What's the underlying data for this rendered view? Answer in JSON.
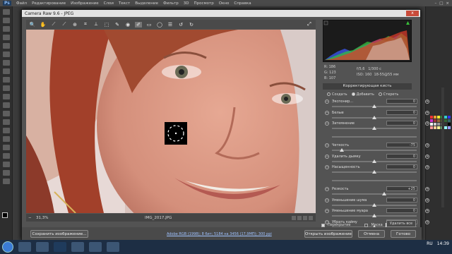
{
  "ps_menu": {
    "logo": "Ps",
    "items": [
      "Файл",
      "Редактирование",
      "Изображение",
      "Слои",
      "Текст",
      "Выделение",
      "Фильтр",
      "3D",
      "Просмотр",
      "Окно",
      "Справка"
    ]
  },
  "dialog": {
    "title": "Camera Raw 9.6  -  JPEG",
    "close": "x"
  },
  "preview": {
    "zoom": "31,3%",
    "filename": "IMG_2017.JPG"
  },
  "toolbar_icons": [
    "zoom-icon",
    "hand-icon",
    "white-balance-icon",
    "color-sampler-icon",
    "target-adjust-icon",
    "crop-icon",
    "straighten-icon",
    "transform-icon",
    "spot-removal-icon",
    "red-eye-icon",
    "adjustment-brush-icon",
    "graduated-filter-icon",
    "radial-filter-icon",
    "preferences-icon",
    "rotate-left-icon",
    "rotate-right-icon"
  ],
  "rgb": {
    "r_label": "R:",
    "r": "186",
    "g_label": "G:",
    "g": "123",
    "b_label": "B:",
    "b": "107",
    "aperture": "f/5,6",
    "shutter": "1/300 с",
    "iso": "ISO: 160",
    "lens": "18-55@55 мм"
  },
  "panel": {
    "title": "Корректирующая кисть",
    "new": "Создать",
    "add": "Добавить",
    "erase": "Стереть"
  },
  "sliders": [
    {
      "label": "Экспонир...",
      "value": "0",
      "pos": 0.5
    },
    {
      "label": "Белые",
      "value": "0",
      "pos": 0.5
    },
    {
      "label": "Затемнение",
      "value": "0",
      "pos": 0.5
    },
    {
      "label": "",
      "value": "",
      "pos": null
    },
    {
      "label": "Четкость",
      "value": "-75",
      "pos": 0.12
    },
    {
      "label": "Удалить дымку",
      "value": "0",
      "pos": 0.5
    },
    {
      "label": "Насыщенность",
      "value": "0",
      "pos": 0.5
    },
    {
      "label": "",
      "value": "",
      "pos": null
    },
    {
      "label": "Резкость",
      "value": "+25",
      "pos": 0.62
    },
    {
      "label": "Уменьшение шума",
      "value": "0",
      "pos": 0.5
    },
    {
      "label": "Уменьшение муара",
      "value": "0",
      "pos": 0.5
    },
    {
      "label": "Убрать кайму",
      "value": "0",
      "pos": 0.5
    },
    {
      "label": "",
      "value": "",
      "pos": null
    }
  ],
  "options": {
    "overlay": "Перекрытие",
    "mask": "Маска",
    "reset": "Удалить все"
  },
  "bottom": {
    "save": "Сохранить изображение...",
    "workflow": "Adobe RGB (1998); 8 бит; 5184 на 3456 (17,9МП); 300 ppi",
    "open": "Открыть изображение",
    "cancel": "Отмена",
    "done": "Готово"
  },
  "taskbar": {
    "lang": "RU",
    "time": "14:39"
  },
  "colors": {
    "hist_red": "#e23a2a",
    "hist_green": "#38c03a",
    "hist_blue": "#3a55e8"
  }
}
